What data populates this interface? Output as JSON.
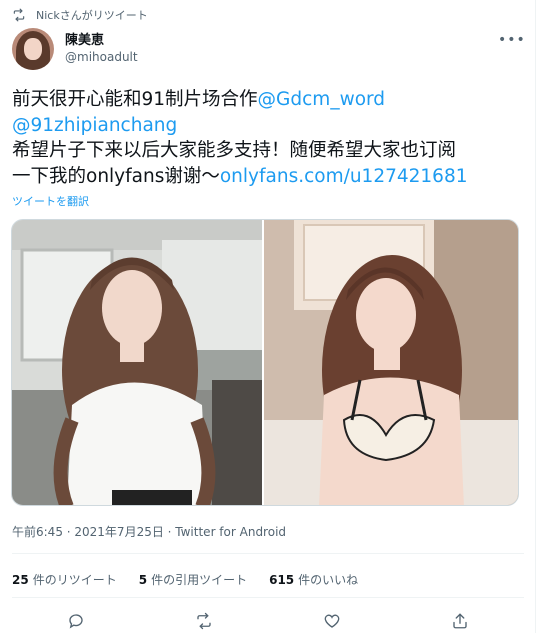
{
  "retweet_banner": {
    "text": "Nickさんがリツイート"
  },
  "author": {
    "display_name": "陳美恵",
    "handle": "@mihoadult"
  },
  "tweet": {
    "line1": "前天很开心能和91制片场合作",
    "mention1": "@Gdcm_word",
    "mention2": "@91zhipianchang",
    "line3": "希望片子下来以后大家能多支持！随便希望大家也订阅",
    "line4": "一下我的onlyfans谢谢～",
    "url": "onlyfans.com/u127421681"
  },
  "translate_label": "ツイートを翻訳",
  "meta": {
    "timestamp": "午前6:45 · 2021年7月25日 · Twitter for Android"
  },
  "stats": {
    "retweets": {
      "count": "25",
      "label": "件のリツイート"
    },
    "quotes": {
      "count": "5",
      "label": "件の引用ツイート"
    },
    "likes": {
      "count": "615",
      "label": "件のいいね"
    }
  },
  "icons": {
    "retweet_banner": "retweet-icon",
    "more": "more-icon",
    "reply": "reply-icon",
    "retweet": "retweet-icon",
    "like": "heart-icon",
    "share": "share-icon"
  },
  "colors": {
    "link": "#1d9bf0",
    "secondary": "#536471",
    "primary_text": "#0f1419",
    "divider": "#eff3f4"
  }
}
